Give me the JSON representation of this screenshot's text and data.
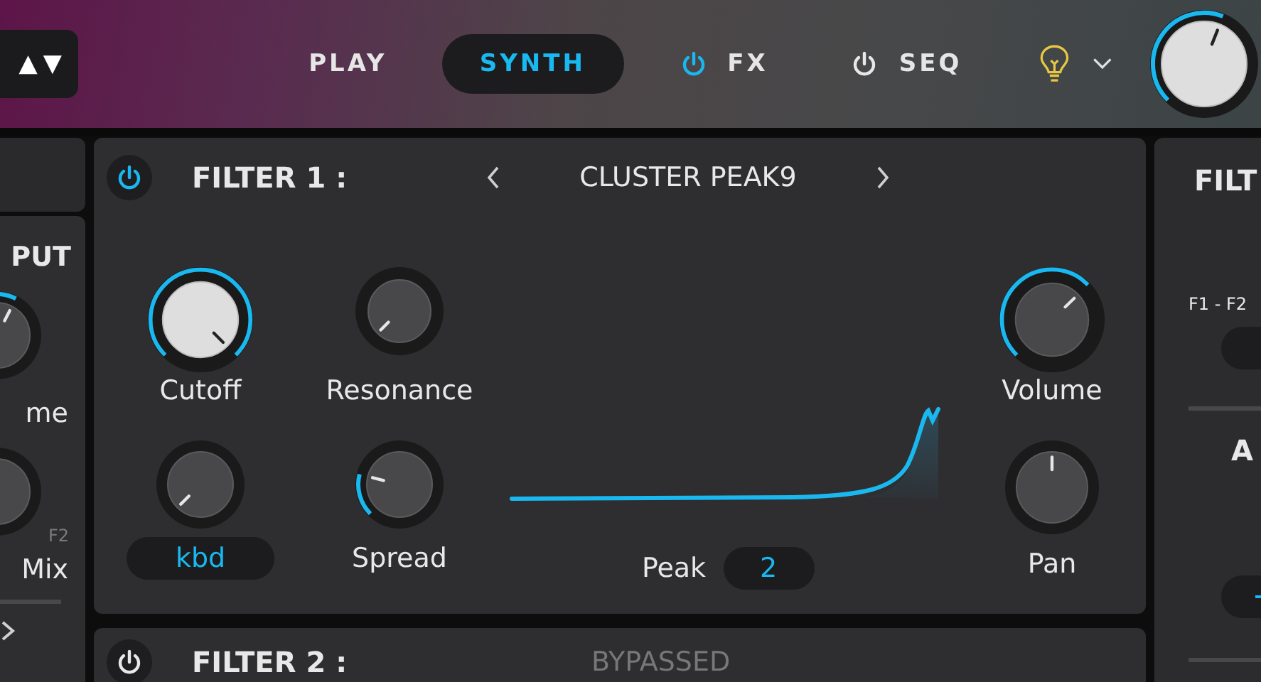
{
  "top_bar": {
    "preset_arrows": "▲▼",
    "tabs": [
      {
        "label": "PLAY",
        "selected": false,
        "kind": "plain"
      },
      {
        "label": "SYNTH",
        "selected": true,
        "kind": "plain"
      },
      {
        "label": "FX",
        "selected": false,
        "kind": "power",
        "on": true
      },
      {
        "label": "SEQ",
        "selected": false,
        "kind": "power",
        "on": false
      }
    ]
  },
  "left_panel": {
    "title": "PUT",
    "knobs": [
      {
        "label": "me"
      },
      {
        "label": "Mix",
        "tag": "F2"
      }
    ]
  },
  "filter_1": {
    "power_on": true,
    "title": "FILTER 1 :",
    "preset": "CLUSTER PEAK9",
    "knobs": [
      {
        "kind": "label",
        "label": "Cutoff"
      },
      {
        "kind": "label",
        "label": "Resonance"
      },
      {
        "kind": "label",
        "label": "Volume"
      },
      {
        "kind": "field",
        "value": "kbd"
      },
      {
        "kind": "label",
        "label": "Spread"
      },
      {
        "kind": "label",
        "label": "Pan"
      }
    ],
    "peak": {
      "label": "Peak",
      "value": "2"
    }
  },
  "filter_2": {
    "power_on": false,
    "title": "FILTER 2 :",
    "status": "BYPASSED"
  },
  "right_panel": {
    "title": "FILT",
    "routing_label": "F1 - F2",
    "section_title": "A"
  }
}
